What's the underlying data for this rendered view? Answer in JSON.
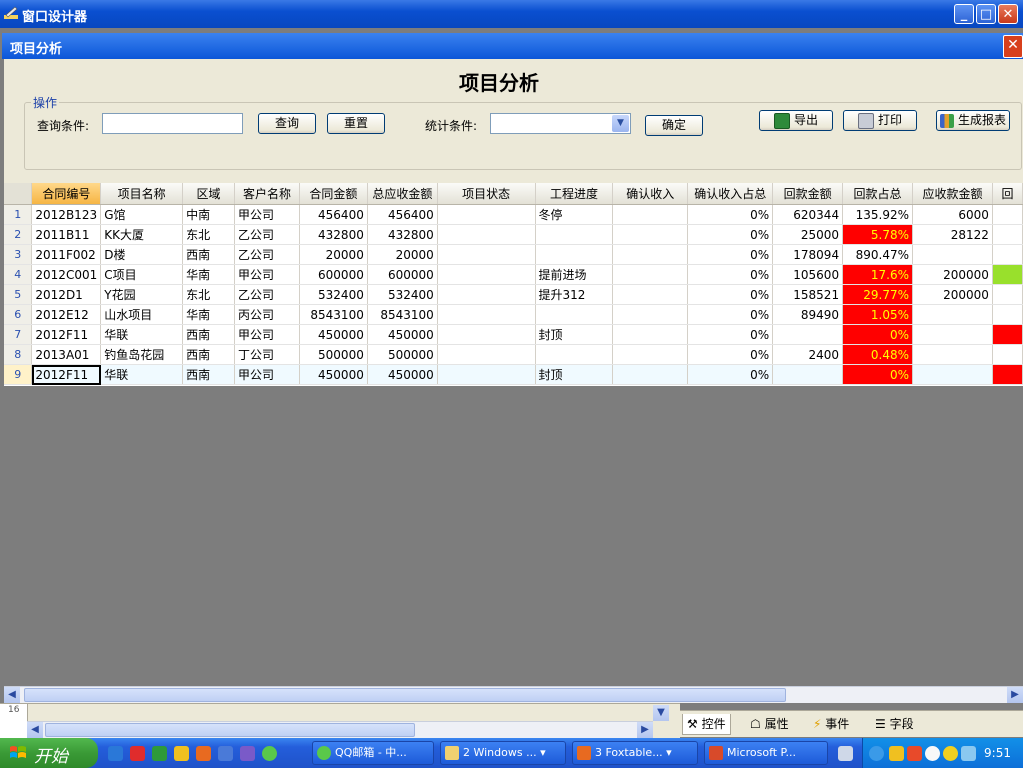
{
  "window": {
    "title": "窗口设计器",
    "controls": [
      "_",
      "□",
      "✕"
    ]
  },
  "form": {
    "title": "项目分析",
    "page_title": "项目分析",
    "group_label": "操作",
    "query_label": "查询条件:",
    "query_value": "",
    "query_button": "查询",
    "reset_button": "重置",
    "stat_label": "统计条件:",
    "stat_value": "",
    "confirm_button": "确定",
    "export_button": "导出",
    "print_button": "打印",
    "report_button": "生成报表"
  },
  "grid": {
    "columns": [
      "合同编号",
      "项目名称",
      "区域",
      "客户名称",
      "合同金额",
      "总应收金额",
      "项目状态",
      "工程进度",
      "确认收入",
      "确认收入占总",
      "回款金额",
      "回款占总",
      "应收款金额",
      "回"
    ],
    "rows": [
      {
        "n": "1",
        "c": [
          "2012B123",
          "G馆",
          "中南",
          "甲公司",
          "456400",
          "456400",
          "",
          "冬停",
          "",
          "0%",
          "620344",
          "135.92%",
          "6000",
          ""
        ],
        "flags": {}
      },
      {
        "n": "2",
        "c": [
          "2011B11",
          "KK大厦",
          "东北",
          "乙公司",
          "432800",
          "432800",
          "",
          "",
          "",
          "0%",
          "25000",
          "5.78%",
          "28122",
          ""
        ],
        "flags": {
          "red": true
        }
      },
      {
        "n": "3",
        "c": [
          "2011F002",
          "D楼",
          "西南",
          "乙公司",
          "20000",
          "20000",
          "",
          "",
          "",
          "0%",
          "178094",
          "890.47%",
          "",
          ""
        ],
        "flags": {}
      },
      {
        "n": "4",
        "c": [
          "2012C001",
          "C项目",
          "华南",
          "甲公司",
          "600000",
          "600000",
          "",
          "提前进场",
          "",
          "0%",
          "105600",
          "17.6%",
          "200000",
          ""
        ],
        "flags": {
          "red": true,
          "last": "green"
        }
      },
      {
        "n": "5",
        "c": [
          "2012D1",
          "Y花园",
          "东北",
          "乙公司",
          "532400",
          "532400",
          "",
          "提升312",
          "",
          "0%",
          "158521",
          "29.77%",
          "200000",
          ""
        ],
        "flags": {
          "red": true
        }
      },
      {
        "n": "6",
        "c": [
          "2012E12",
          "山水项目",
          "华南",
          "丙公司",
          "8543100",
          "8543100",
          "",
          "",
          "",
          "0%",
          "89490",
          "1.05%",
          "",
          ""
        ],
        "flags": {
          "red": true
        }
      },
      {
        "n": "7",
        "c": [
          "2012F11",
          "华联",
          "西南",
          "甲公司",
          "450000",
          "450000",
          "",
          "封顶",
          "",
          "0%",
          "",
          "0%",
          "",
          ""
        ],
        "flags": {
          "red": true,
          "last": "red"
        }
      },
      {
        "n": "8",
        "c": [
          "2013A01",
          "钓鱼岛花园",
          "西南",
          "丁公司",
          "500000",
          "500000",
          "",
          "",
          "",
          "0%",
          "2400",
          "0.48%",
          "",
          ""
        ],
        "flags": {
          "red": true
        }
      },
      {
        "n": "9",
        "c": [
          "2012F11",
          "华联",
          "西南",
          "甲公司",
          "450000",
          "450000",
          "",
          "封顶",
          "",
          "0%",
          "",
          "0%",
          "",
          ""
        ],
        "flags": {
          "red": true,
          "last": "red",
          "current": true
        }
      }
    ]
  },
  "bottom": {
    "ruler_value": "16",
    "tabs": [
      "控件",
      "属性",
      "事件",
      "字段"
    ]
  },
  "taskbar": {
    "start": "开始",
    "tasks": [
      "QQ邮箱 - 中...",
      "2 Windows ...",
      "3 Foxtable...",
      "Microsoft P..."
    ],
    "clock": "9:51"
  }
}
